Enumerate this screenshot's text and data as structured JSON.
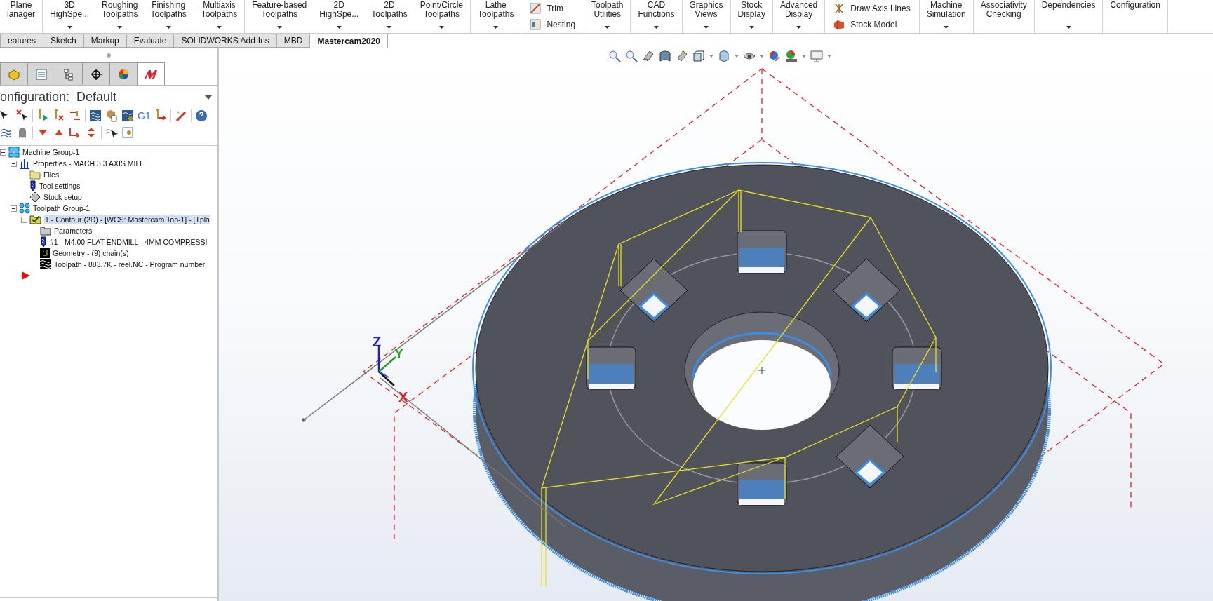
{
  "ribbon": {
    "groups": [
      {
        "items": [
          {
            "kind": "big",
            "lines": [
              "Plane",
              "lanager"
            ],
            "caret": false
          }
        ]
      },
      {
        "items": [
          {
            "kind": "big",
            "lines": [
              "3D",
              "HighSpe..."
            ],
            "caret": true
          },
          {
            "kind": "big",
            "lines": [
              "Roughing",
              "Toolpaths"
            ],
            "caret": true
          },
          {
            "kind": "big",
            "lines": [
              "Finishing",
              "Toolpaths"
            ],
            "caret": true
          }
        ]
      },
      {
        "items": [
          {
            "kind": "big",
            "lines": [
              "Multiaxis",
              "Toolpaths"
            ],
            "caret": true
          }
        ]
      },
      {
        "items": [
          {
            "kind": "big",
            "lines": [
              "Feature-based",
              "Toolpaths"
            ],
            "caret": true
          },
          {
            "kind": "big",
            "lines": [
              "2D",
              "HighSpe..."
            ],
            "caret": true
          },
          {
            "kind": "big",
            "lines": [
              "2D",
              "Toolpaths"
            ],
            "caret": true
          },
          {
            "kind": "big",
            "lines": [
              "Point/Circle",
              "Toolpaths"
            ],
            "caret": true
          }
        ]
      },
      {
        "items": [
          {
            "kind": "big",
            "lines": [
              "Lathe",
              "Toolpaths"
            ],
            "caret": true
          }
        ]
      },
      {
        "items": [
          {
            "kind": "small",
            "label": "Trim"
          },
          {
            "kind": "small",
            "label": "Nesting"
          }
        ]
      },
      {
        "items": [
          {
            "kind": "big",
            "lines": [
              "Toolpath",
              "Utilities"
            ],
            "caret": true
          }
        ]
      },
      {
        "items": [
          {
            "kind": "big",
            "lines": [
              "CAD",
              "Functions"
            ],
            "caret": true
          }
        ]
      },
      {
        "items": [
          {
            "kind": "big",
            "lines": [
              "Graphics",
              "Views"
            ],
            "caret": true
          }
        ]
      },
      {
        "items": [
          {
            "kind": "big",
            "lines": [
              "Stock",
              "Display"
            ],
            "caret": true
          }
        ]
      },
      {
        "items": [
          {
            "kind": "big",
            "lines": [
              "Advanced",
              "Display"
            ],
            "caret": true
          }
        ]
      },
      {
        "items": [
          {
            "kind": "small",
            "label": "Draw Axis Lines"
          },
          {
            "kind": "small",
            "label": "Stock Model"
          }
        ]
      },
      {
        "items": [
          {
            "kind": "big",
            "lines": [
              "Machine",
              "Simulation"
            ],
            "caret": true
          }
        ]
      },
      {
        "items": [
          {
            "kind": "big",
            "lines": [
              "Associativity",
              "Checking"
            ],
            "caret": false
          }
        ]
      },
      {
        "items": [
          {
            "kind": "big",
            "lines": [
              "Dependencies"
            ],
            "caret": true
          }
        ]
      },
      {
        "items": [
          {
            "kind": "big",
            "lines": [
              "Configuration"
            ],
            "caret": false
          }
        ]
      }
    ]
  },
  "tabs": [
    {
      "label": "eatures",
      "selected": false
    },
    {
      "label": "Sketch",
      "selected": false
    },
    {
      "label": "Markup",
      "selected": false
    },
    {
      "label": "Evaluate",
      "selected": false
    },
    {
      "label": "SOLIDWORKS Add-Ins",
      "selected": false
    },
    {
      "label": "MBD",
      "selected": false
    },
    {
      "label": "Mastercam2020",
      "selected": true
    }
  ],
  "panel": {
    "tabs": [
      {
        "kind": "part",
        "selected": false
      },
      {
        "kind": "properties",
        "selected": false
      },
      {
        "kind": "config",
        "selected": false
      },
      {
        "kind": "target",
        "selected": false
      },
      {
        "kind": "appearance",
        "selected": false
      },
      {
        "kind": "mastercam",
        "selected": true
      }
    ],
    "configuration": "onfiguration:  Default",
    "toolbar_text": "G1",
    "tree": [
      {
        "label": "Machine Group-1",
        "kind": "machine",
        "selected": false,
        "expanded": true,
        "children": [
          {
            "label": "Properties - MACH 3 3 AXIS MILL",
            "kind": "properties",
            "selected": false,
            "expanded": true,
            "children": [
              {
                "label": "Files",
                "kind": "folder",
                "selected": false
              },
              {
                "label": "Tool settings",
                "kind": "tool",
                "selected": false
              },
              {
                "label": "Stock setup",
                "kind": "stock",
                "selected": false
              }
            ]
          },
          {
            "label": "Toolpath Group-1",
            "kind": "group",
            "selected": false,
            "expanded": true,
            "children": [
              {
                "label": "1 - Contour (2D) - [WCS: Mastercam Top-1] - [Tpla",
                "kind": "operation",
                "selected": true,
                "expanded": true,
                "children": [
                  {
                    "label": "Parameters",
                    "kind": "parameters",
                    "selected": false
                  },
                  {
                    "label": "#1 - M4.00 FLAT ENDMILL - 4MM COMPRESSI",
                    "kind": "tool",
                    "selected": false
                  },
                  {
                    "label": "Geometry - (9) chain(s)",
                    "kind": "geometry",
                    "selected": false
                  },
                  {
                    "label": "Toolpath - 883.7K - reel.NC - Program number",
                    "kind": "toolpath",
                    "selected": false
                  }
                ]
              }
            ]
          }
        ]
      }
    ]
  },
  "viewport": {
    "triad_labels": [
      "Z",
      "Y",
      "X"
    ]
  }
}
